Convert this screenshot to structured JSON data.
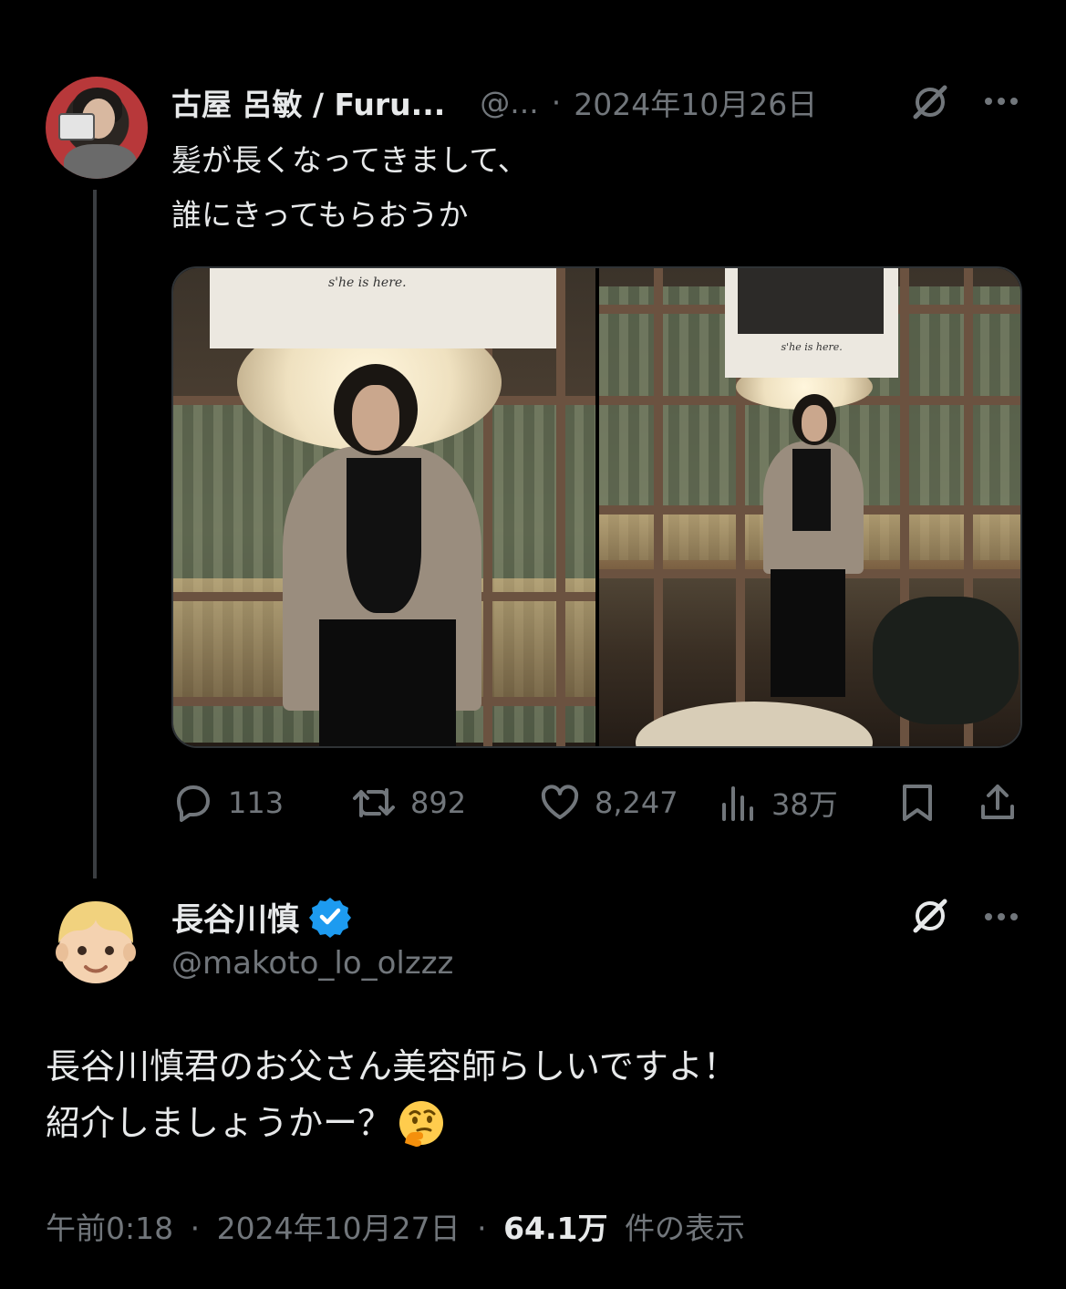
{
  "parent": {
    "author_name": "古屋 呂敏 / Furu...",
    "handle": "@...",
    "separator": "·",
    "date": "2024年10月26日",
    "text_lines": [
      "髪が長くなってきまして、",
      "誰にきってもらおうか"
    ],
    "photo1_caption": "s'he is here.",
    "photo2_caption": "s'he is here.",
    "stats": {
      "replies": "113",
      "retweets": "892",
      "likes": "8,247",
      "views": "38万"
    }
  },
  "reply": {
    "author_name": "長谷川慎",
    "handle": "@makoto_lo_olzzz",
    "text_lines": [
      "長谷川慎君のお父さん美容師らしいですよ！",
      "紹介しましょうかー？"
    ],
    "footer": {
      "time": "午前0:18",
      "separator": "·",
      "date": "2024年10月27日",
      "separator2": "·",
      "views_count": "64.1万",
      "views_label": "件の表示"
    }
  },
  "icons": {
    "grok": "grok-icon",
    "more": "more-icon",
    "reply": "reply-icon",
    "retweet": "retweet-icon",
    "like": "heart-icon",
    "views": "views-icon",
    "bookmark": "bookmark-icon",
    "share": "share-icon",
    "verified": "verified-badge-icon",
    "thinking": "thinking-face-icon"
  },
  "colors": {
    "background": "#000000",
    "text": "#e7e9ea",
    "muted": "#71767b",
    "verified": "#1d9bf0"
  }
}
